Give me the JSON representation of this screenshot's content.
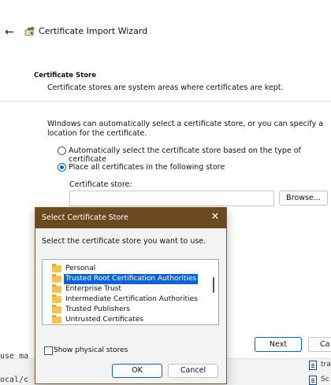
{
  "wizard": {
    "title": "Certificate Import Wizard",
    "section_title": "Certificate Store",
    "section_desc": "Certificate stores are system areas where certificates are kept.",
    "intro": "Windows can automatically select a certificate store, or you can specify a location for the certificate.",
    "radio_auto": "Automatically select the certificate store based on the type of certificate",
    "radio_place": "Place all certificates in the following store",
    "store_label": "Certificate store:",
    "store_value": "",
    "browse_label": "Browse...",
    "next_label": "Next",
    "cancel_label_partial": "Ca"
  },
  "background": {
    "terminal_line1": "use ma",
    "terminal_line2": "ocal/c",
    "file1": "tra",
    "file2": "Sc"
  },
  "dialog": {
    "title": "Select Certificate Store",
    "prompt": "Select the certificate store you want to use.",
    "stores": [
      {
        "label": "Personal",
        "selected": false
      },
      {
        "label": "Trusted Root Certification Authorities",
        "selected": true
      },
      {
        "label": "Enterprise Trust",
        "selected": false
      },
      {
        "label": "Intermediate Certification Authorities",
        "selected": false
      },
      {
        "label": "Trusted Publishers",
        "selected": false
      },
      {
        "label": "Untrusted Certificates",
        "selected": false
      }
    ],
    "show_physical_label": "Show physical stores",
    "show_physical_checked": false,
    "ok_label": "OK",
    "cancel_label": "Cancel"
  },
  "colors": {
    "dialog_titlebar": "#6b4a22",
    "selection": "#0a64d8",
    "accent": "#0067c0"
  }
}
